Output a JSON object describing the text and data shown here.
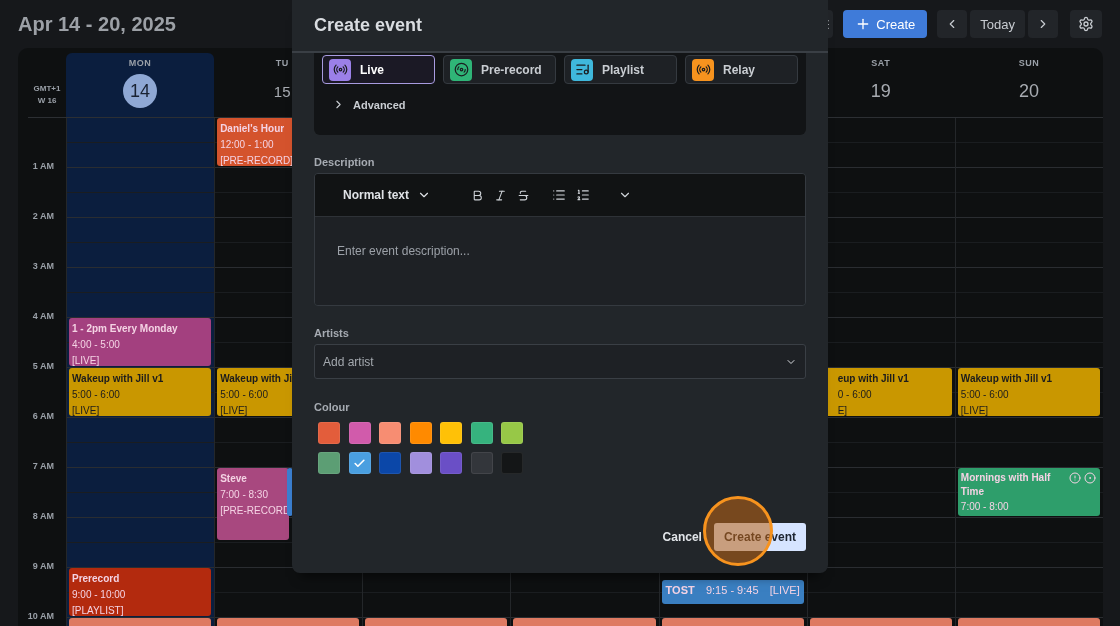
{
  "header": {
    "title": "Apr 14 - 20, 2025",
    "create": "Create",
    "today": "Today"
  },
  "calendar": {
    "timezone": "GMT+1",
    "week": "W 16",
    "hours": [
      "1 AM",
      "2 AM",
      "3 AM",
      "4 AM",
      "5 AM",
      "6 AM",
      "7 AM",
      "8 AM",
      "9 AM",
      "10 AM"
    ],
    "columns": [
      {
        "day": {
          "name": "MON",
          "date": "14",
          "selected": true
        },
        "events": [
          {
            "kind": "block",
            "title": "1 - 2pm Every Monday",
            "time": "4:00 - 5:00",
            "tag": "[LIVE]",
            "color": "#a3407f"
          },
          {
            "kind": "block",
            "title": "Wakeup with Jill v1",
            "time": "5:00 - 6:00",
            "tag": "[LIVE]",
            "color": "#c99700"
          },
          {
            "kind": "block",
            "title": "Prerecord",
            "time": "9:00 - 10:00",
            "tag": "[PLAYLIST]",
            "color": "#b32a0e"
          },
          {
            "kind": "strip",
            "color": "#de7a62"
          }
        ]
      },
      {
        "day": {
          "name": "TU",
          "date": "15",
          "selected": false
        },
        "events": [
          {
            "kind": "block",
            "title": "Daniel's Hour",
            "time": "12:00 - 1:00",
            "tag": "[PRE-RECORD]",
            "color": "#d4532d"
          },
          {
            "kind": "block",
            "title": "Wakeup with Ji",
            "time": "5:00 - 6:00",
            "tag": "[LIVE]",
            "color": "#c99700"
          },
          {
            "kind": "block",
            "title": "Steve",
            "time": "7:00 - 8:30",
            "tag": "[PRE-RECORD",
            "color": "#a8487f"
          },
          {
            "kind": "strip",
            "color": "#3b7fd0"
          },
          {
            "kind": "strip",
            "color": "#de7a62"
          }
        ]
      },
      {
        "events": [
          {
            "kind": "strip",
            "color": "#de7a62"
          }
        ]
      },
      {
        "events": [
          {
            "kind": "strip",
            "color": "#de7a62"
          }
        ]
      },
      {
        "events": [
          {
            "kind": "inline",
            "title": "TOST",
            "time": "9:15 - 9:45",
            "tag": "[LIVE]",
            "color": "#3a7fc1"
          },
          {
            "kind": "strip",
            "color": "#de7a62"
          }
        ]
      },
      {
        "day": {
          "name": "SAT",
          "date": "19",
          "selected": false
        },
        "events": [
          {
            "kind": "block",
            "title": "eup with Jill v1",
            "time": "0 - 6:00",
            "tag": "E]",
            "color": "#c99700"
          },
          {
            "kind": "strip",
            "color": "#de7a62"
          }
        ]
      },
      {
        "day": {
          "name": "SUN",
          "date": "20",
          "selected": false
        },
        "events": [
          {
            "kind": "block",
            "title": "Wakeup with Jill v1",
            "time": "5:00 - 6:00",
            "tag": "[LIVE]",
            "color": "#c99700"
          },
          {
            "kind": "block",
            "title": "Mornings with Half Time",
            "time": "7:00 - 8:00",
            "color": "#2e9e6b",
            "alert": true,
            "recording": true
          },
          {
            "kind": "strip",
            "color": "#de7a62"
          }
        ]
      }
    ]
  },
  "modal": {
    "title": "Create event",
    "types": [
      {
        "kind": "live",
        "label": "Live",
        "selected": true,
        "color": "#9b80e8"
      },
      {
        "kind": "prerecord",
        "label": "Pre-record",
        "selected": false,
        "color": "#2fb577"
      },
      {
        "kind": "playlist",
        "label": "Playlist",
        "selected": false,
        "color": "#3fb8dc"
      },
      {
        "kind": "relay",
        "label": "Relay",
        "selected": false,
        "color": "#f7931e"
      }
    ],
    "advanced": {
      "label": "Advanced",
      "expanded": false
    },
    "description": {
      "label": "Description",
      "style": "Normal text",
      "placeholder": "Enter event description..."
    },
    "artists": {
      "label": "Artists",
      "placeholder": "Add artist"
    },
    "colour": {
      "label": "Colour",
      "swatches": [
        {
          "color": "#e35d3b",
          "selected": false
        },
        {
          "color": "#d15bab",
          "selected": false
        },
        {
          "color": "#f78d72",
          "selected": false
        },
        {
          "color": "#ff8a00",
          "selected": false
        },
        {
          "color": "#ffc107",
          "selected": false
        },
        {
          "color": "#36b37e",
          "selected": false
        },
        {
          "color": "#97c847",
          "selected": false
        },
        {
          "color": "#5c9e74",
          "selected": false
        },
        {
          "color": "#4a9fe0",
          "selected": true
        },
        {
          "color": "#0b47a8",
          "selected": false
        },
        {
          "color": "#a18fdd",
          "selected": false
        },
        {
          "color": "#6a4fc6",
          "selected": false
        },
        {
          "color": "#33363b",
          "selected": false
        },
        {
          "color": "#141617",
          "selected": false
        }
      ]
    },
    "cancel": "Cancel",
    "submit": "Create event",
    "click_highlight": true
  }
}
